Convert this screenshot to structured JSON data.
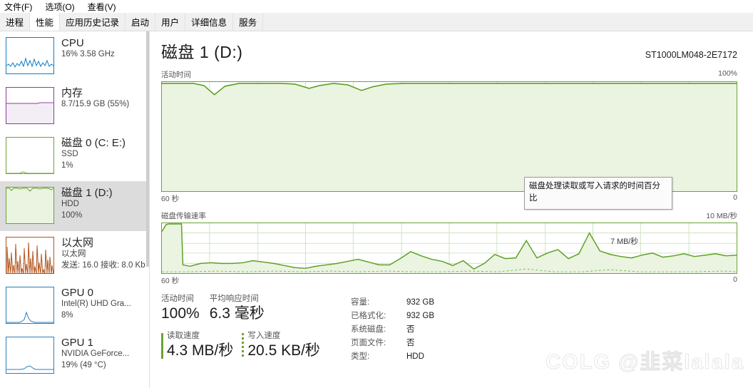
{
  "menu": {
    "items": [
      {
        "label": "文件(F)",
        "name": "menu-file"
      },
      {
        "label": "选项(O)",
        "name": "menu-options"
      },
      {
        "label": "查看(V)",
        "name": "menu-view"
      }
    ]
  },
  "tabs": [
    {
      "label": "进程",
      "active": false
    },
    {
      "label": "性能",
      "active": true
    },
    {
      "label": "应用历史记录",
      "active": false
    },
    {
      "label": "启动",
      "active": false
    },
    {
      "label": "用户",
      "active": false
    },
    {
      "label": "详细信息",
      "active": false
    },
    {
      "label": "服务",
      "active": false
    }
  ],
  "sidebar": {
    "items": [
      {
        "title": "CPU",
        "sub1": "16% 3.58 GHz",
        "sub2": "",
        "selected": false,
        "color": "#0b7fc4"
      },
      {
        "title": "内存",
        "sub1": "8.7/15.9 GB (55%)",
        "sub2": "",
        "selected": false,
        "color": "#8e3a9e"
      },
      {
        "title": "磁盘 0 (C: E:)",
        "sub1": "SSD",
        "sub2": "1%",
        "selected": false,
        "color": "#6aa432"
      },
      {
        "title": "磁盘 1 (D:)",
        "sub1": "HDD",
        "sub2": "100%",
        "selected": true,
        "color": "#6aa432"
      },
      {
        "title": "以太网",
        "sub1": "以太网",
        "sub2": "发送: 16.0 接收: 8.0 Kb",
        "selected": false,
        "color": "#b3541e"
      },
      {
        "title": "GPU 0",
        "sub1": "Intel(R) UHD Gra...",
        "sub2": "8%",
        "selected": false,
        "color": "#2b7fb8"
      },
      {
        "title": "GPU 1",
        "sub1": "NVIDIA GeForce...",
        "sub2": "19% (49 °C)",
        "selected": false,
        "color": "#2b7fb8"
      }
    ]
  },
  "main": {
    "title": "磁盘 1 (D:)",
    "model": "ST1000LM048-2E7172",
    "graph1": {
      "label": "活动时间",
      "max_label": "100%",
      "time_label": "60 秒",
      "min_label": "0"
    },
    "graph2": {
      "label": "磁盘传输速率",
      "max_label": "10 MB/秒",
      "time_label": "60 秒",
      "min_label": "0",
      "peak_annotation": "7 MB/秒"
    },
    "tooltip": "磁盘处理读取或写入请求的时间百分比",
    "stats_left": {
      "active_time_label": "活动时间",
      "active_time_value": "100%",
      "avg_response_label": "平均响应时间",
      "avg_response_value": "6.3 毫秒",
      "read_label": "读取速度",
      "read_value": "4.3 MB/秒",
      "write_label": "写入速度",
      "write_value": "20.5 KB/秒"
    },
    "stats_right": [
      {
        "key": "容量:",
        "value": "932 GB"
      },
      {
        "key": "已格式化:",
        "value": "932 GB"
      },
      {
        "key": "系统磁盘:",
        "value": "否"
      },
      {
        "key": "页面文件:",
        "value": "否"
      },
      {
        "key": "类型:",
        "value": "HDD"
      }
    ]
  },
  "watermark": "COLG @韭菜lalala",
  "chart_data": [
    {
      "type": "area",
      "title": "活动时间",
      "ylabel": "%",
      "ylim": [
        0,
        100
      ],
      "xlabel": "60 秒",
      "grid": true,
      "color": "#6aa432",
      "fill": "#eaf4e0",
      "values": [
        100,
        100,
        100,
        100,
        100,
        97,
        88,
        100,
        100,
        100,
        100,
        100,
        100,
        100,
        97,
        99,
        100,
        99,
        96,
        92,
        96,
        100,
        100,
        100,
        100,
        100,
        100,
        100,
        100,
        100,
        100,
        100,
        100,
        100,
        100,
        100,
        100,
        100,
        100,
        100,
        100,
        100,
        100,
        100,
        100,
        100,
        100,
        100,
        100,
        100,
        100,
        100,
        100,
        100,
        100,
        100,
        100,
        100,
        100,
        100
      ]
    },
    {
      "type": "area",
      "title": "磁盘传输速率",
      "ylabel": "MB/秒",
      "ylim": [
        0,
        10
      ],
      "xlabel": "60 秒",
      "grid": true,
      "color": "#6aa432",
      "fill": "#eaf4e0",
      "peak_annotation": "7 MB/秒",
      "values": [
        8.4,
        9.8,
        9.9,
        9.9,
        9.9,
        9.9,
        1.2,
        1.5,
        2.0,
        1.9,
        1.8,
        1.8,
        1.9,
        2.4,
        2.2,
        1.8,
        1.5,
        1.2,
        1.1,
        1.4,
        1.6,
        1.9,
        2.3,
        2.6,
        2.2,
        1.7,
        1.7,
        2.6,
        4.3,
        3.6,
        2.9,
        2.5,
        1.6,
        2.3,
        1.0,
        1.9,
        3.2,
        2.5,
        2.6,
        6.4,
        2.6,
        3.5,
        4.1,
        2.6,
        3.6,
        7.0,
        3.0,
        2.8
      ]
    }
  ]
}
